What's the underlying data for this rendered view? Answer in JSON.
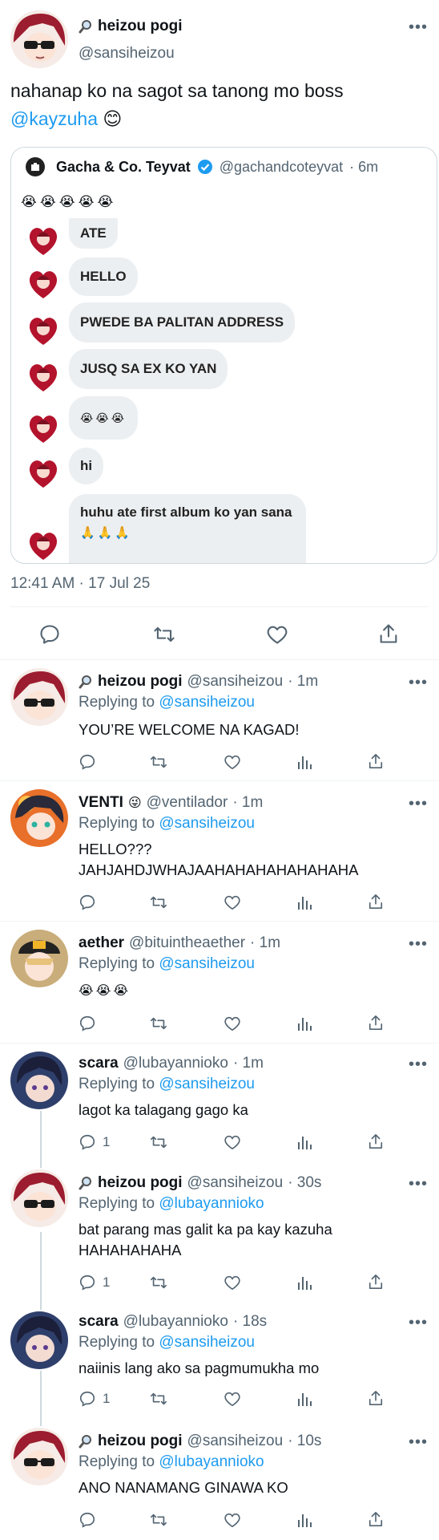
{
  "main": {
    "author_name": "heizou pogi",
    "author_handle": "@sansiheizou",
    "name_prefix_icon": "magnifier-icon",
    "text_line1": "nahanap ko na sagot sa tanong mo boss",
    "mention": "@kayzuha",
    "text_emoji": "😊",
    "timestamp": "12:41 AM · 17 Jul 25",
    "quote": {
      "account_name": "Gacha & Co. Teyvat",
      "account_handle": "@gachandcoteyvat",
      "time": "· 6m",
      "verified": true,
      "emoji_line": "😭😭😭😭😭",
      "messages": [
        {
          "text": "ATE"
        },
        {
          "text": "HELLO"
        },
        {
          "text": "PWEDE BA PALITAN ADDRESS"
        },
        {
          "text": "JUSQ SA EX KO YAN"
        },
        {
          "text": "😭😭😭"
        },
        {
          "text": "hi"
        },
        {
          "text": "huhu ate first album ko yan sana"
        },
        {
          "text": "🙏🙏🙏"
        }
      ]
    }
  },
  "replying_label": "Replying to",
  "replies": [
    {
      "name": "heizou pogi",
      "handle": "@sansiheizou",
      "time": "· 1m",
      "reply_to": "@sansiheizou",
      "text": "YOU’RE WELCOME NA KAGAD!",
      "text2": "",
      "replies_count": ""
    },
    {
      "name": "VENTI",
      "name_emoji": "😜",
      "handle": "@ventilador",
      "time": "· 1m",
      "reply_to": "@sansiheizou",
      "text": "HELLO???",
      "text2": "JAHJAHDJWHAJAAHAHAHAHAHAHAHA",
      "replies_count": ""
    },
    {
      "name": "aether",
      "handle": "@bituintheaether",
      "time": "· 1m",
      "reply_to": "@sansiheizou",
      "text": "😭😭😭",
      "text2": "",
      "replies_count": ""
    },
    {
      "name": "scara",
      "handle": "@lubayannioko",
      "time": "· 1m",
      "reply_to": "@sansiheizou",
      "text": "lagot ka talagang gago ka",
      "text2": "",
      "replies_count": "1"
    },
    {
      "name": "heizou pogi",
      "handle": "@sansiheizou",
      "time": "· 30s",
      "reply_to": "@lubayannioko",
      "text": "bat parang mas galit ka pa kay kazuha",
      "text2": "HAHAHAHAHA",
      "replies_count": "1"
    },
    {
      "name": "scara",
      "handle": "@lubayannioko",
      "time": "· 18s",
      "reply_to": "@sansiheizou",
      "text": "naiinis lang ako sa pagmumukha mo",
      "text2": "",
      "replies_count": "1"
    },
    {
      "name": "heizou pogi",
      "handle": "@sansiheizou",
      "time": "· 10s",
      "reply_to": "@lubayannioko",
      "text": "ANO NANAMANG GINAWA KO",
      "text2": "",
      "replies_count": ""
    }
  ],
  "colors": {
    "accent": "#1d9bf0",
    "muted": "#536471",
    "border": "#cfd9de"
  },
  "icons": [
    "more-icon",
    "reply-icon",
    "retweet-icon",
    "like-icon",
    "views-icon",
    "share-icon",
    "verified-icon"
  ]
}
